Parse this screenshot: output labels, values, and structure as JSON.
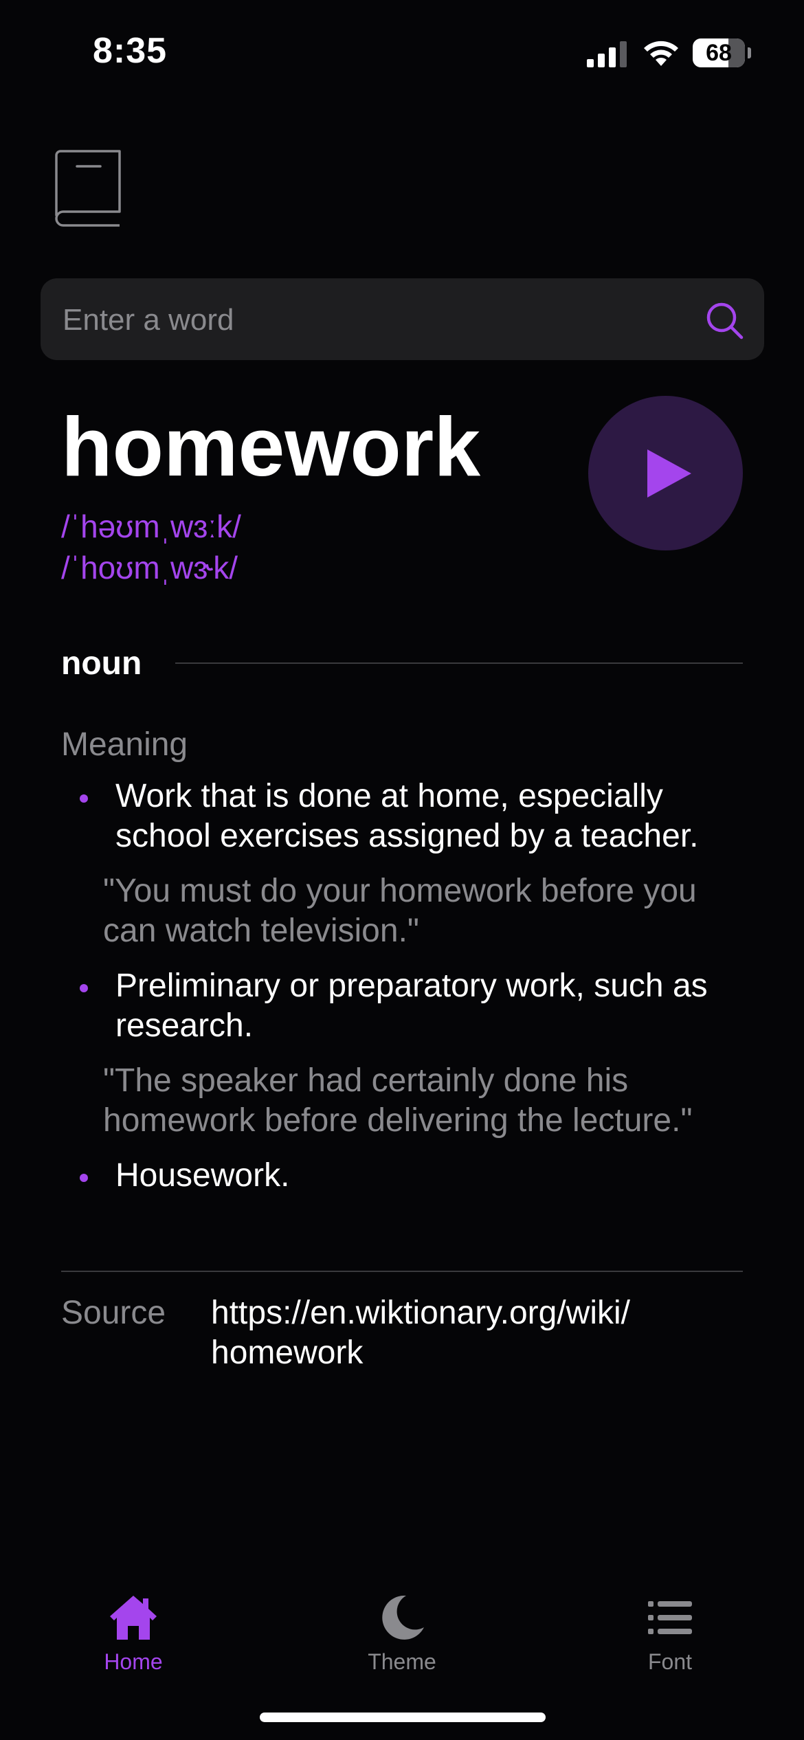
{
  "status_bar": {
    "time": "8:35",
    "battery": "68",
    "icons": [
      "signal-icon",
      "wifi-icon",
      "battery-icon"
    ]
  },
  "app": {
    "logo_icon": "book-icon"
  },
  "search": {
    "placeholder": "Enter a word",
    "value": "",
    "icon": "search-icon"
  },
  "word": {
    "title": "homework",
    "phonetics": [
      "/ˈhəʊmˌwɜːk/",
      "/ˈhoʊmˌwɝk/"
    ],
    "play_icon": "play-icon"
  },
  "meanings": {
    "part_of_speech": "noun",
    "heading": "Meaning",
    "definitions": [
      {
        "text": "Work that is done at home, especially school exercises assigned by a teacher.",
        "example": "\"You must do your homework before you can watch television.\""
      },
      {
        "text": "Preliminary or preparatory work, such as research.",
        "example": "\"The speaker had certainly done his homework before delivering the lecture.\""
      },
      {
        "text": "Housework.",
        "example": ""
      }
    ]
  },
  "source": {
    "label": "Source",
    "url": "https://en.wiktionary.org/wiki/homework"
  },
  "tab_bar": {
    "tabs": [
      {
        "label": "Home",
        "icon": "home-icon",
        "active": true
      },
      {
        "label": "Theme",
        "icon": "moon-icon",
        "active": false
      },
      {
        "label": "Font",
        "icon": "list-icon",
        "active": false
      }
    ]
  },
  "colors": {
    "accent": "#a445ed",
    "background": "#050507",
    "search_bg": "#1e1e20",
    "muted_text": "#8a8a8e"
  }
}
